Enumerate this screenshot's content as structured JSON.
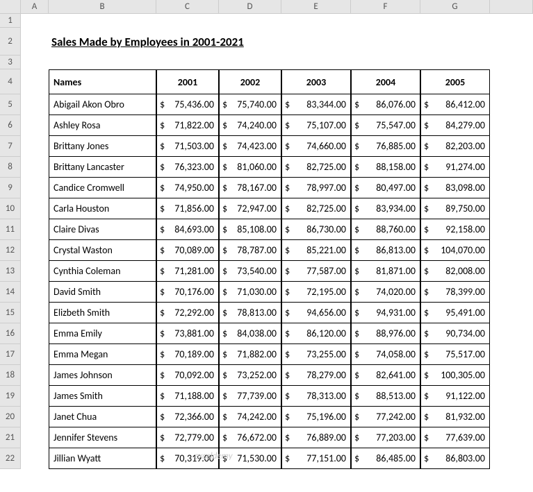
{
  "columns": [
    "A",
    "B",
    "C",
    "D",
    "E",
    "F",
    "G"
  ],
  "row_numbers": [
    1,
    2,
    3,
    4,
    5,
    6,
    7,
    8,
    9,
    10,
    11,
    12,
    13,
    14,
    15,
    16,
    17,
    18,
    19,
    20,
    21,
    22
  ],
  "title": "Sales Made by Employees in 2001-2021",
  "watermark": "exceldemy",
  "table": {
    "name_header": "Names",
    "year_headers": [
      "2001",
      "2002",
      "2003",
      "2004",
      "2005"
    ],
    "rows": [
      {
        "name": "Abigail Akon Obro",
        "v": [
          "75,436.00",
          "75,740.00",
          "83,344.00",
          "86,076.00",
          "86,412.00"
        ]
      },
      {
        "name": "Ashley Rosa",
        "v": [
          "71,822.00",
          "74,240.00",
          "75,107.00",
          "75,547.00",
          "84,279.00"
        ]
      },
      {
        "name": "Brittany Jones",
        "v": [
          "71,503.00",
          "74,423.00",
          "74,660.00",
          "76,885.00",
          "82,203.00"
        ]
      },
      {
        "name": "Brittany Lancaster",
        "v": [
          "76,323.00",
          "81,060.00",
          "82,725.00",
          "88,158.00",
          "91,274.00"
        ]
      },
      {
        "name": "Candice Cromwell",
        "v": [
          "74,950.00",
          "78,167.00",
          "78,997.00",
          "80,497.00",
          "83,098.00"
        ]
      },
      {
        "name": "Carla Houston",
        "v": [
          "71,856.00",
          "72,947.00",
          "82,725.00",
          "83,934.00",
          "89,750.00"
        ]
      },
      {
        "name": "Claire Divas",
        "v": [
          "84,693.00",
          "85,108.00",
          "86,730.00",
          "88,760.00",
          "92,158.00"
        ]
      },
      {
        "name": "Crystal Waston",
        "v": [
          "70,089.00",
          "78,787.00",
          "85,221.00",
          "86,813.00",
          "104,070.00"
        ]
      },
      {
        "name": "Cynthia Coleman",
        "v": [
          "71,281.00",
          "73,540.00",
          "77,587.00",
          "81,871.00",
          "82,008.00"
        ]
      },
      {
        "name": "David Smith",
        "v": [
          "70,176.00",
          "71,030.00",
          "72,195.00",
          "74,020.00",
          "78,399.00"
        ]
      },
      {
        "name": "Elizbeth Smith",
        "v": [
          "72,292.00",
          "78,813.00",
          "94,656.00",
          "94,931.00",
          "95,491.00"
        ]
      },
      {
        "name": "Emma Emily",
        "v": [
          "73,881.00",
          "84,038.00",
          "86,120.00",
          "88,976.00",
          "90,734.00"
        ]
      },
      {
        "name": "Emma Megan",
        "v": [
          "70,189.00",
          "71,882.00",
          "73,255.00",
          "74,058.00",
          "75,517.00"
        ]
      },
      {
        "name": "James Johnson",
        "v": [
          "70,092.00",
          "73,252.00",
          "78,279.00",
          "82,641.00",
          "100,305.00"
        ]
      },
      {
        "name": "James Smith",
        "v": [
          "71,188.00",
          "77,739.00",
          "78,313.00",
          "88,513.00",
          "91,122.00"
        ]
      },
      {
        "name": "Janet Chua",
        "v": [
          "72,366.00",
          "74,242.00",
          "75,196.00",
          "77,242.00",
          "81,932.00"
        ]
      },
      {
        "name": "Jennifer Stevens",
        "v": [
          "72,779.00",
          "76,672.00",
          "76,889.00",
          "77,203.00",
          "77,639.00"
        ]
      },
      {
        "name": "Jillian Wyatt",
        "v": [
          "70,319.00",
          "71,530.00",
          "77,151.00",
          "86,485.00",
          "86,803.00"
        ]
      }
    ]
  }
}
